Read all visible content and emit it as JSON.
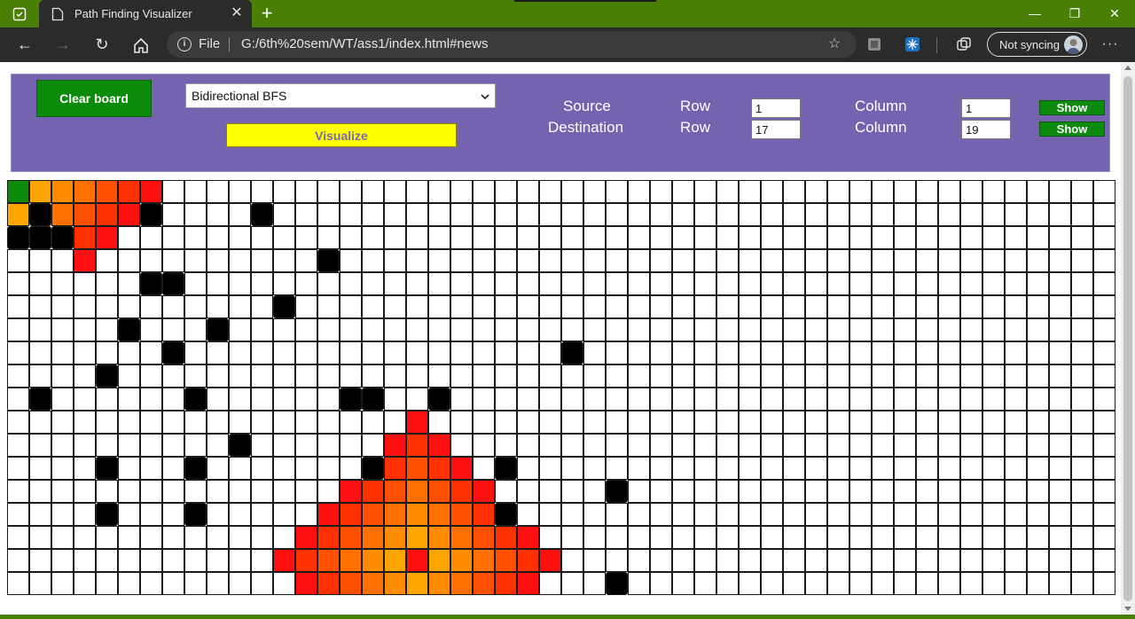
{
  "browser": {
    "tab_title": "Path Finding Visualizer",
    "address_scheme": "File",
    "url": "G:/6th%20sem/WT/ass1/index.html#news",
    "profile_label": "Not syncing"
  },
  "controls": {
    "clear_label": "Clear board",
    "algorithm_selected": "Bidirectional BFS",
    "visualize_label": "Visualize",
    "source_label": "Source",
    "destination_label": "Destination",
    "row_label": "Row",
    "column_label": "Column",
    "source_row": "1",
    "source_col": "1",
    "dest_row": "17",
    "dest_col": "19",
    "show_label": "Show"
  },
  "colors": {
    "panel": "#7563b0",
    "start": "#0b8a0b",
    "wall": "#000000",
    "empty": "#ffffff",
    "visited_gradient": [
      "#ffa500",
      "#ff8c00",
      "#ff7000",
      "#ff5000",
      "#ff3000",
      "#ff1010"
    ]
  },
  "grid": {
    "rows": 18,
    "cols": 50,
    "start": [
      0,
      0
    ],
    "walls": [
      [
        1,
        1
      ],
      [
        1,
        6
      ],
      [
        1,
        11
      ],
      [
        2,
        0
      ],
      [
        2,
        1
      ],
      [
        2,
        2
      ],
      [
        3,
        14
      ],
      [
        4,
        6
      ],
      [
        4,
        7
      ],
      [
        5,
        12
      ],
      [
        6,
        5
      ],
      [
        6,
        9
      ],
      [
        7,
        7
      ],
      [
        7,
        25
      ],
      [
        8,
        4
      ],
      [
        9,
        1
      ],
      [
        9,
        8
      ],
      [
        9,
        15
      ],
      [
        9,
        16
      ],
      [
        9,
        19
      ],
      [
        11,
        10
      ],
      [
        12,
        4
      ],
      [
        12,
        8
      ],
      [
        12,
        16
      ],
      [
        12,
        22
      ],
      [
        13,
        27
      ],
      [
        14,
        4
      ],
      [
        14,
        8
      ],
      [
        14,
        22
      ],
      [
        17,
        27
      ]
    ],
    "visited": [
      [
        0,
        1,
        0
      ],
      [
        0,
        2,
        1
      ],
      [
        0,
        3,
        2
      ],
      [
        0,
        4,
        3
      ],
      [
        0,
        5,
        4
      ],
      [
        0,
        6,
        5
      ],
      [
        1,
        0,
        0
      ],
      [
        1,
        2,
        2
      ],
      [
        1,
        3,
        3
      ],
      [
        1,
        4,
        4
      ],
      [
        1,
        5,
        5
      ],
      [
        2,
        3,
        4
      ],
      [
        2,
        4,
        5
      ],
      [
        3,
        3,
        5
      ],
      [
        10,
        18,
        5
      ],
      [
        11,
        17,
        5
      ],
      [
        11,
        18,
        4
      ],
      [
        11,
        19,
        5
      ],
      [
        12,
        17,
        4
      ],
      [
        12,
        18,
        3
      ],
      [
        12,
        19,
        4
      ],
      [
        12,
        20,
        5
      ],
      [
        13,
        15,
        5
      ],
      [
        13,
        16,
        4
      ],
      [
        13,
        17,
        3
      ],
      [
        13,
        18,
        2
      ],
      [
        13,
        19,
        3
      ],
      [
        13,
        20,
        4
      ],
      [
        13,
        21,
        5
      ],
      [
        14,
        14,
        5
      ],
      [
        14,
        15,
        4
      ],
      [
        14,
        16,
        3
      ],
      [
        14,
        17,
        2
      ],
      [
        14,
        18,
        1
      ],
      [
        14,
        19,
        2
      ],
      [
        14,
        20,
        3
      ],
      [
        14,
        21,
        4
      ],
      [
        15,
        13,
        5
      ],
      [
        15,
        14,
        4
      ],
      [
        15,
        15,
        3
      ],
      [
        15,
        16,
        2
      ],
      [
        15,
        17,
        1
      ],
      [
        15,
        18,
        0
      ],
      [
        15,
        19,
        1
      ],
      [
        15,
        20,
        2
      ],
      [
        15,
        21,
        3
      ],
      [
        15,
        22,
        4
      ],
      [
        15,
        23,
        5
      ],
      [
        16,
        12,
        5
      ],
      [
        16,
        13,
        4
      ],
      [
        16,
        14,
        3
      ],
      [
        16,
        15,
        2
      ],
      [
        16,
        16,
        1
      ],
      [
        16,
        17,
        0
      ],
      [
        16,
        18,
        5
      ],
      [
        16,
        19,
        0
      ],
      [
        16,
        20,
        1
      ],
      [
        16,
        21,
        2
      ],
      [
        16,
        22,
        3
      ],
      [
        16,
        23,
        4
      ],
      [
        16,
        24,
        5
      ],
      [
        17,
        13,
        5
      ],
      [
        17,
        14,
        4
      ],
      [
        17,
        15,
        3
      ],
      [
        17,
        16,
        2
      ],
      [
        17,
        17,
        1
      ],
      [
        17,
        18,
        0
      ],
      [
        17,
        19,
        1
      ],
      [
        17,
        20,
        2
      ],
      [
        17,
        21,
        3
      ],
      [
        17,
        22,
        4
      ],
      [
        17,
        23,
        5
      ]
    ]
  }
}
